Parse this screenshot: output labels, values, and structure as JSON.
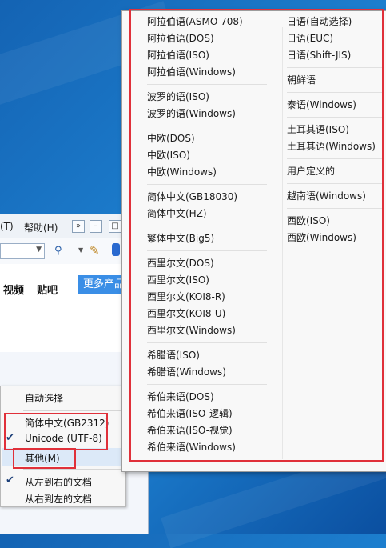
{
  "browser": {
    "menu": {
      "tools_fragment": "(T)",
      "help": "帮助(H)",
      "chevrons": "»",
      "minimize": "–",
      "maximize": "□"
    },
    "nav": {
      "video": "视频",
      "tieba": "贴吧",
      "more_products": "更多产品"
    }
  },
  "context_menu": {
    "items": [
      {
        "label": "自动选择",
        "checked": false
      },
      {
        "label": "简体中文(GB2312)",
        "checked": false
      },
      {
        "label": "Unicode (UTF-8)",
        "checked": true
      },
      {
        "label": "其他(M)",
        "checked": false,
        "highlighted": true
      },
      {
        "label": "从左到右的文档",
        "checked": true
      },
      {
        "label": "从右到左的文档",
        "checked": false
      }
    ],
    "check_glyph": "✔"
  },
  "encoding_menu": {
    "left_column": [
      [
        "阿拉伯语(ASMO 708)",
        "阿拉伯语(DOS)",
        "阿拉伯语(ISO)",
        "阿拉伯语(Windows)"
      ],
      [
        "波罗的语(ISO)",
        "波罗的语(Windows)"
      ],
      [
        "中欧(DOS)",
        "中欧(ISO)",
        "中欧(Windows)"
      ],
      [
        "简体中文(GB18030)",
        "简体中文(HZ)"
      ],
      [
        "繁体中文(Big5)"
      ],
      [
        "西里尔文(DOS)",
        "西里尔文(ISO)",
        "西里尔文(KOI8-R)",
        "西里尔文(KOI8-U)",
        "西里尔文(Windows)"
      ],
      [
        "希腊语(ISO)",
        "希腊语(Windows)"
      ],
      [
        "希伯来语(DOS)",
        "希伯来语(ISO-逻辑)",
        "希伯来语(ISO-视觉)",
        "希伯来语(Windows)"
      ]
    ],
    "right_column": [
      [
        "日语(自动选择)",
        "日语(EUC)",
        "日语(Shift-JIS)"
      ],
      [
        "朝鲜语"
      ],
      [
        "泰语(Windows)"
      ],
      [
        "土耳其语(ISO)",
        "土耳其语(Windows)"
      ],
      [
        "用户定义的"
      ],
      [
        "越南语(Windows)"
      ],
      [
        "西欧(ISO)",
        "西欧(Windows)"
      ]
    ]
  },
  "colors": {
    "highlight_box": "#e0303a",
    "desktop": "#1f86d6"
  }
}
